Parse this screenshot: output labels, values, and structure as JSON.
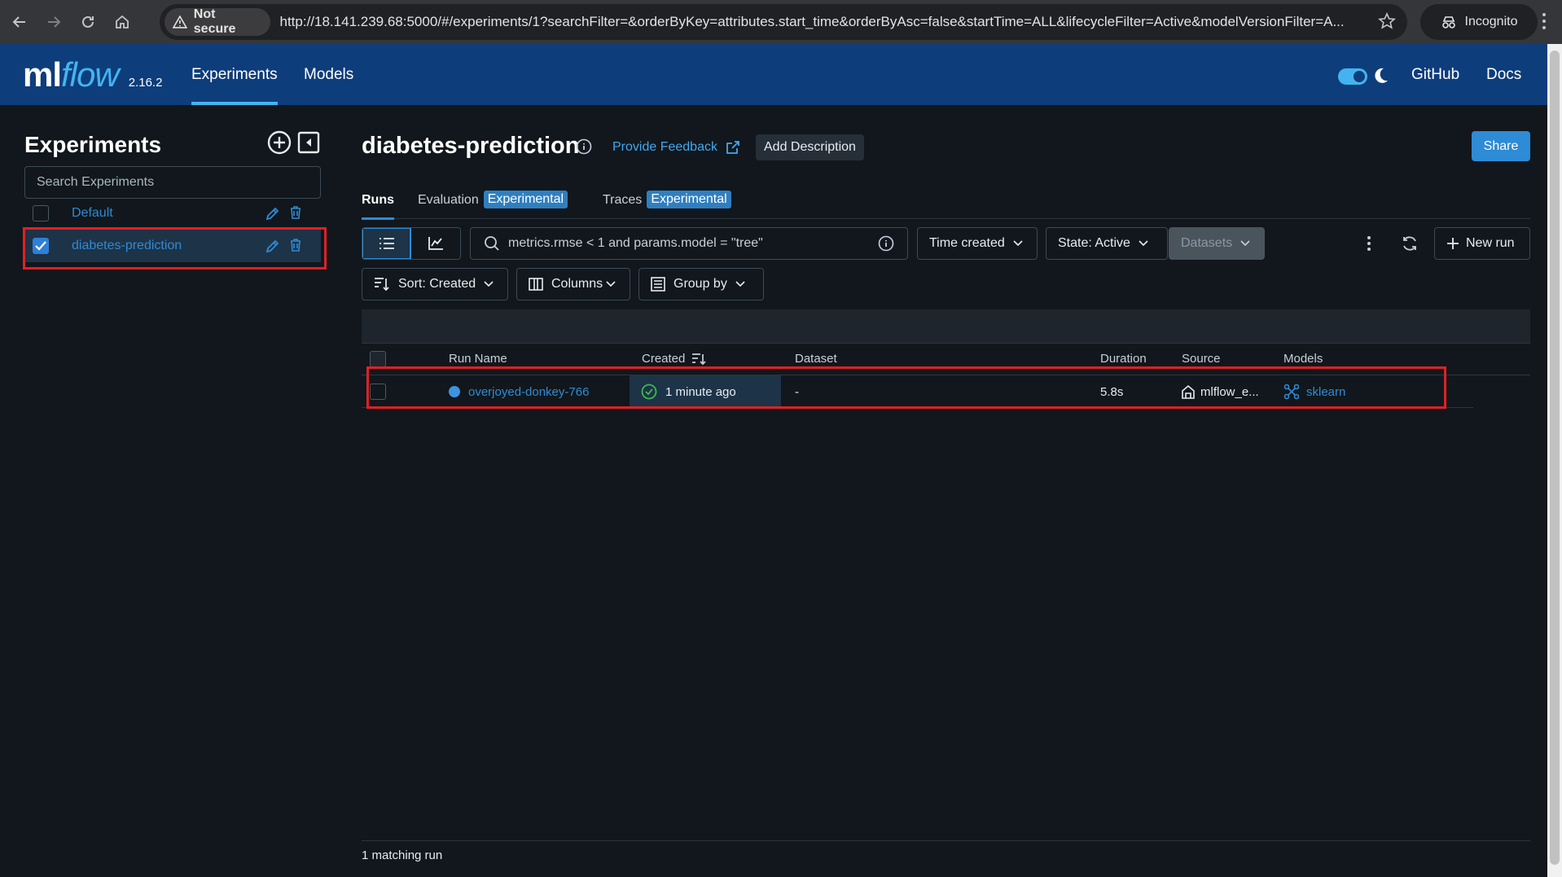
{
  "browser": {
    "not_secure_label": "Not secure",
    "url": "http://18.141.239.68:5000/#/experiments/1?searchFilter=&orderByKey=attributes.start_time&orderByAsc=false&startTime=ALL&lifecycleFilter=Active&modelVersionFilter=A...",
    "incognito_label": "Incognito"
  },
  "header": {
    "logo_ml": "ml",
    "logo_flow": "flow",
    "version": "2.16.2",
    "nav": {
      "experiments": "Experiments",
      "models": "Models",
      "github": "GitHub",
      "docs": "Docs"
    }
  },
  "sidebar": {
    "title": "Experiments",
    "search_placeholder": "Search Experiments",
    "items": [
      {
        "name": "Default",
        "checked": false
      },
      {
        "name": "diabetes-prediction",
        "checked": true
      }
    ]
  },
  "main": {
    "title": "diabetes-prediction",
    "feedback_label": "Provide Feedback",
    "add_description_label": "Add Description",
    "share_label": "Share",
    "tabs": {
      "runs": "Runs",
      "evaluation": "Evaluation",
      "evaluation_badge": "Experimental",
      "traces": "Traces",
      "traces_badge": "Experimental"
    },
    "toolbar": {
      "search_placeholder": "metrics.rmse < 1 and params.model = \"tree\"",
      "time_created": "Time created",
      "state": "State: Active",
      "datasets": "Datasets",
      "new_run": "New run",
      "sort": "Sort: Created",
      "columns": "Columns",
      "group_by": "Group by"
    },
    "table": {
      "headers": {
        "run_name": "Run Name",
        "created": "Created",
        "dataset": "Dataset",
        "duration": "Duration",
        "source": "Source",
        "models": "Models"
      },
      "rows": [
        {
          "run_name": "overjoyed-donkey-766",
          "created": "1 minute ago",
          "dataset": "-",
          "duration": "5.8s",
          "source": "mlflow_e...",
          "models": "sklearn"
        }
      ]
    },
    "footer": "1 matching run"
  },
  "colors": {
    "header_bg": "#0e3d7b",
    "accent": "#2e8bd6",
    "highlight_border": "#e02025",
    "success": "#3fb950"
  }
}
